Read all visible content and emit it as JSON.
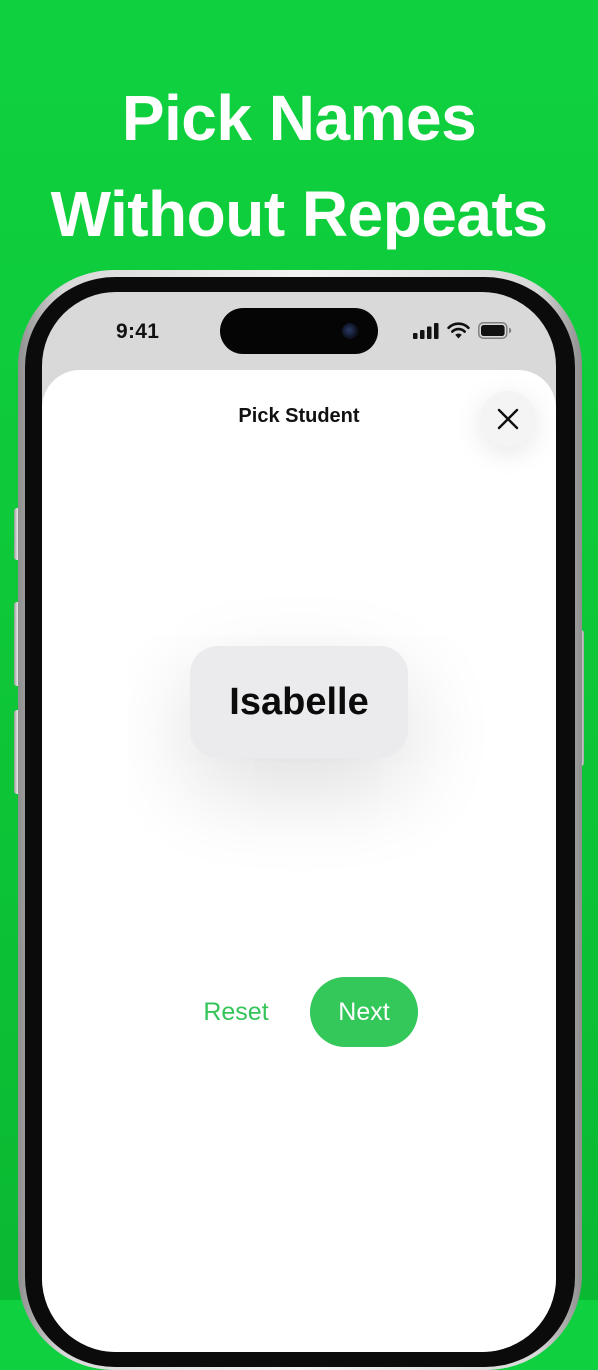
{
  "headline": {
    "line1": "Pick Names",
    "line2": "Without Repeats"
  },
  "status_bar": {
    "time": "9:41",
    "icons": [
      "cellular-signal-icon",
      "wifi-icon",
      "battery-icon"
    ]
  },
  "sheet": {
    "title": "Pick Student",
    "close_icon": "close-icon",
    "picked_name": "Isabelle",
    "reset_label": "Reset",
    "next_label": "Next"
  },
  "colors": {
    "background_green": "#0ec838",
    "accent_green": "#34c759",
    "card_gray": "#ebebed"
  }
}
